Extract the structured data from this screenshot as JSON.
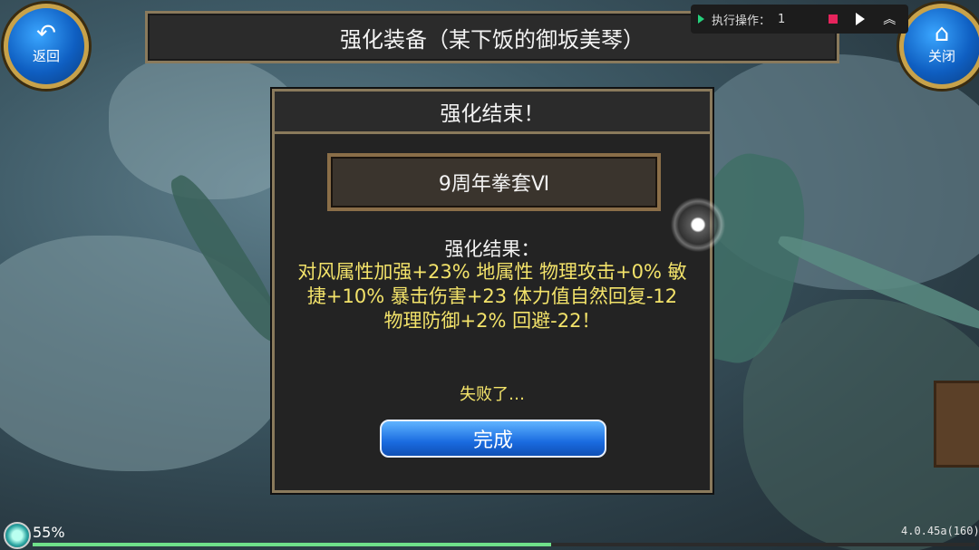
{
  "header": {
    "title": "强化装备（某下饭的御坂美琴）"
  },
  "nav": {
    "back_label": "返回",
    "close_label": "关闭"
  },
  "exec": {
    "label": "执行操作：",
    "count": "1"
  },
  "dialog": {
    "title": "强化结束！",
    "item_name": "9周年拳套Ⅵ",
    "result_label": "强化结果：",
    "result_text": "对风属性加强+23% 地属性 物理攻击+0% 敏捷+10% 暴击伤害+23 体力值自然回复-12 物理防御+2% 回避-22！",
    "fail_text": "失败了…",
    "done_label": "完成"
  },
  "status": {
    "percent": "55%",
    "progress": 0.55,
    "version": "4.0.45a(160)"
  },
  "colors": {
    "accent_blue": "#1a6be0",
    "result_yellow": "#f3e36a",
    "frame_gold": "#8a7a5c"
  }
}
